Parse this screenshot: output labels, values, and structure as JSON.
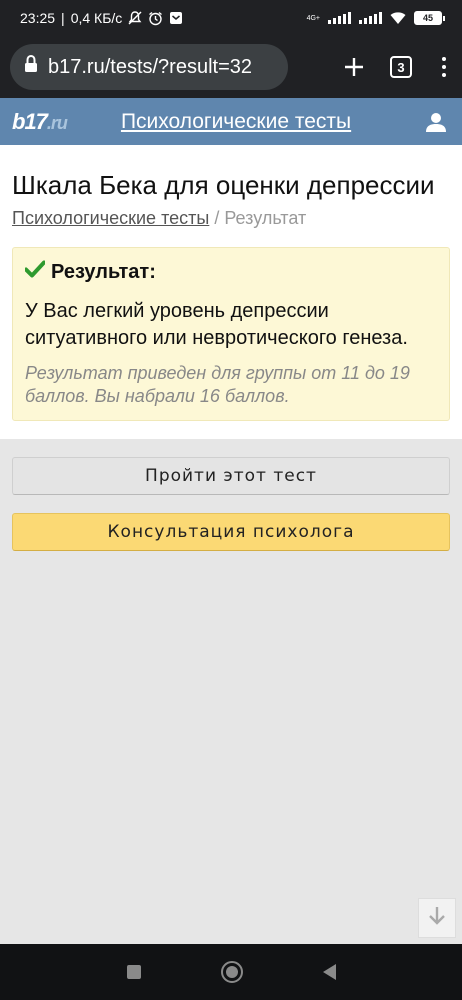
{
  "status_bar": {
    "time": "23:25",
    "network_speed": "0,4 КБ/с",
    "network_type": "4G+",
    "battery": "45"
  },
  "browser": {
    "url": "b17.ru/tests/?result=32",
    "tab_count": "3"
  },
  "site": {
    "logo_main": "b17",
    "logo_suffix": ".ru",
    "section_title": "Психологические тесты"
  },
  "page": {
    "title": "Шкала Бека для оценки депрессии",
    "breadcrumb": {
      "link": "Психологические тесты",
      "separator": " / ",
      "current": "Результат"
    }
  },
  "result": {
    "heading": "Результат:",
    "text": "У Вас легкий уровень депрессии ситуативного или невротического генеза.",
    "note": "Результат приведен для группы от 11 до 19 баллов. Вы набрали 16 баллов."
  },
  "buttons": {
    "take_test": "Пройти этот тест",
    "consultation": "Консультация психолога"
  },
  "colors": {
    "header_bg": "#5f86ae",
    "result_bg": "#fdf8d6",
    "yellow_button": "#fbd974",
    "check_green": "#2e9a2e"
  },
  "icons": {
    "lock": "lock-icon",
    "plus": "new-tab-icon",
    "tabs": "tab-switcher-icon",
    "menu": "more-vert-icon",
    "user": "user-icon",
    "check": "checkmark-icon",
    "scroll": "arrow-down-icon"
  }
}
